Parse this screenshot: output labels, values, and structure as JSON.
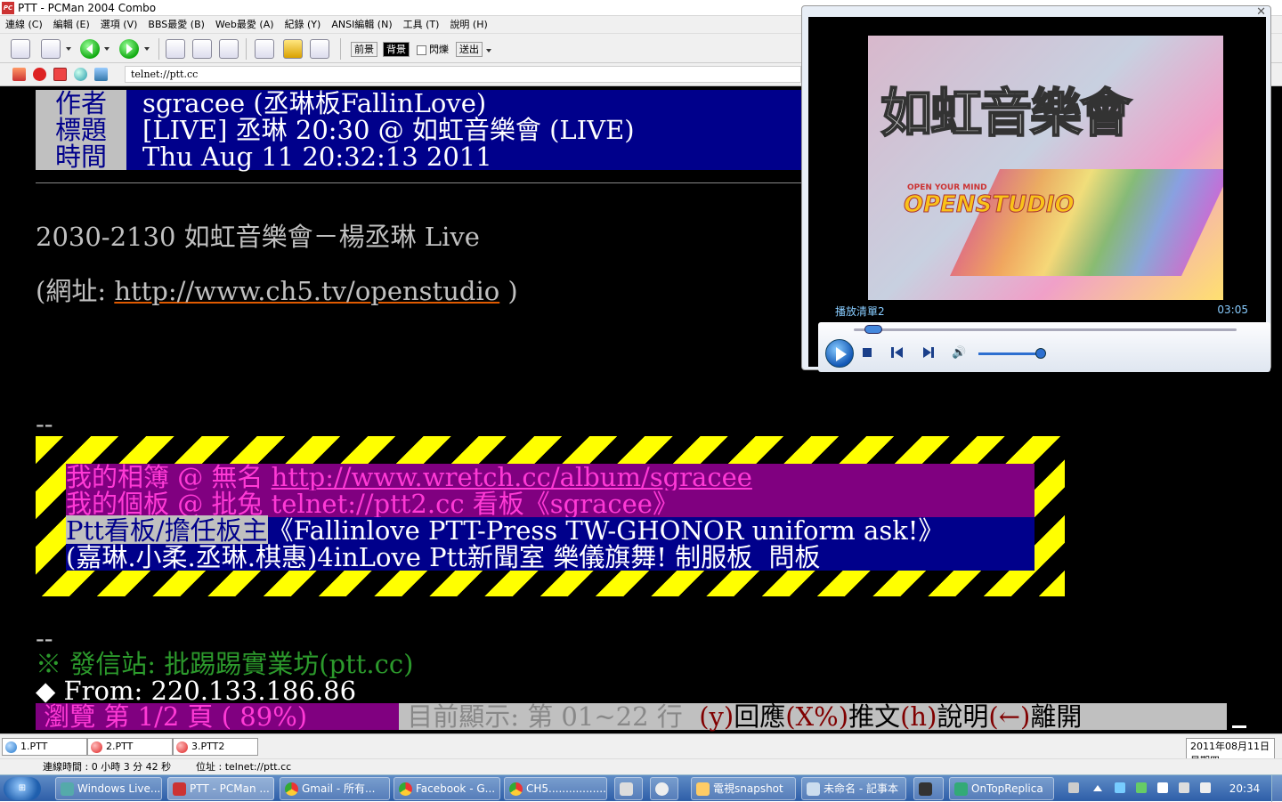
{
  "window": {
    "title": "PTT - PCMan 2004 Combo",
    "icon": "pcman-icon"
  },
  "menu": [
    "連線 (C)",
    "編輯 (E)",
    "選項 (V)",
    "BBS最愛 (B)",
    "Web最愛 (A)",
    "紀錄 (Y)",
    "ANSI編輯 (N)",
    "工具 (T)",
    "說明 (H)"
  ],
  "toolbar": {
    "fg_label": "前景",
    "bg_label": "背景",
    "blink_label": "閃爍",
    "send_label": "送出"
  },
  "address": {
    "value": "telnet://ptt.cc"
  },
  "article": {
    "author_label": "作者",
    "author": "sgracee (丞琳板FallinLove)",
    "title_label": "標題",
    "title": "[LIVE] 丞琳 20:30 @ 如虹音樂會 (LIVE)",
    "time_label": "時間",
    "time": "Thu Aug 11 20:32:13 2011",
    "body_line1": "2030-2130 如虹音樂會－楊丞琳 Live",
    "body_line2_prefix": "(網址: ",
    "body_url": "http://www.ch5.tv/openstudio",
    "body_line2_suffix": " )",
    "sig_sep1": "--",
    "sig_line1_label": "我的相簿 @ 無名 ",
    "sig_line1_url": "http://www.wretch.cc/album/sgracee",
    "sig_line2_label": "我的個板 @ 批兔 ",
    "sig_line2_url": "telnet://ptt2.cc 看板《sgracee》",
    "sig_line3_label": "Ptt看板/擔任板主",
    "sig_line3_value": "《Fallinlove PTT-Press TW-GHONOR uniform ask!》",
    "sig_line4": "(嘉琳.小柔.丞琳.棋惠)4inLove Ptt新聞室 樂儀旗舞! 制服板  問板",
    "sig_sep2": "--",
    "site_line": "※ 發信站: 批踢踢實業坊(ptt.cc)",
    "from_line": "◆ From: 220.133.186.86"
  },
  "status": {
    "browse": " 瀏覽 第 1/2 頁 ( 89%) ",
    "showing": " 目前顯示: 第 01~22 行  ",
    "k1": "(y)",
    "a1": "回應",
    "k2": "(X%)",
    "a2": "推文",
    "k3": "(h)",
    "a3": "說明",
    "k4": "(←)",
    "a4": "離開"
  },
  "player": {
    "playlist": "播放清單2",
    "time": "03:05",
    "video_title": "如虹音樂會",
    "video_brand": "OPENSTUDIO",
    "video_tagline": "OPEN YOUR MIND",
    "seek_fraction": 0.05,
    "volume_fraction": 0.78
  },
  "tabs": [
    "1.PTT",
    "2.PTT",
    "3.PTT2"
  ],
  "date": {
    "line1": "2011年08月11日",
    "line2": "星期四"
  },
  "statusbar": {
    "connected": "連線時間 : 0 小時 3 分 42 秒",
    "location": "位址 : telnet://ptt.cc"
  },
  "taskbar": {
    "items": [
      "Windows Live...",
      "PTT - PCMan ...",
      "Gmail - 所有...",
      "Facebook - G...",
      "CH5...................",
      "電視snapshot",
      "未命名 - 記事本",
      "OnTopReplica"
    ],
    "clock": "20:34"
  }
}
